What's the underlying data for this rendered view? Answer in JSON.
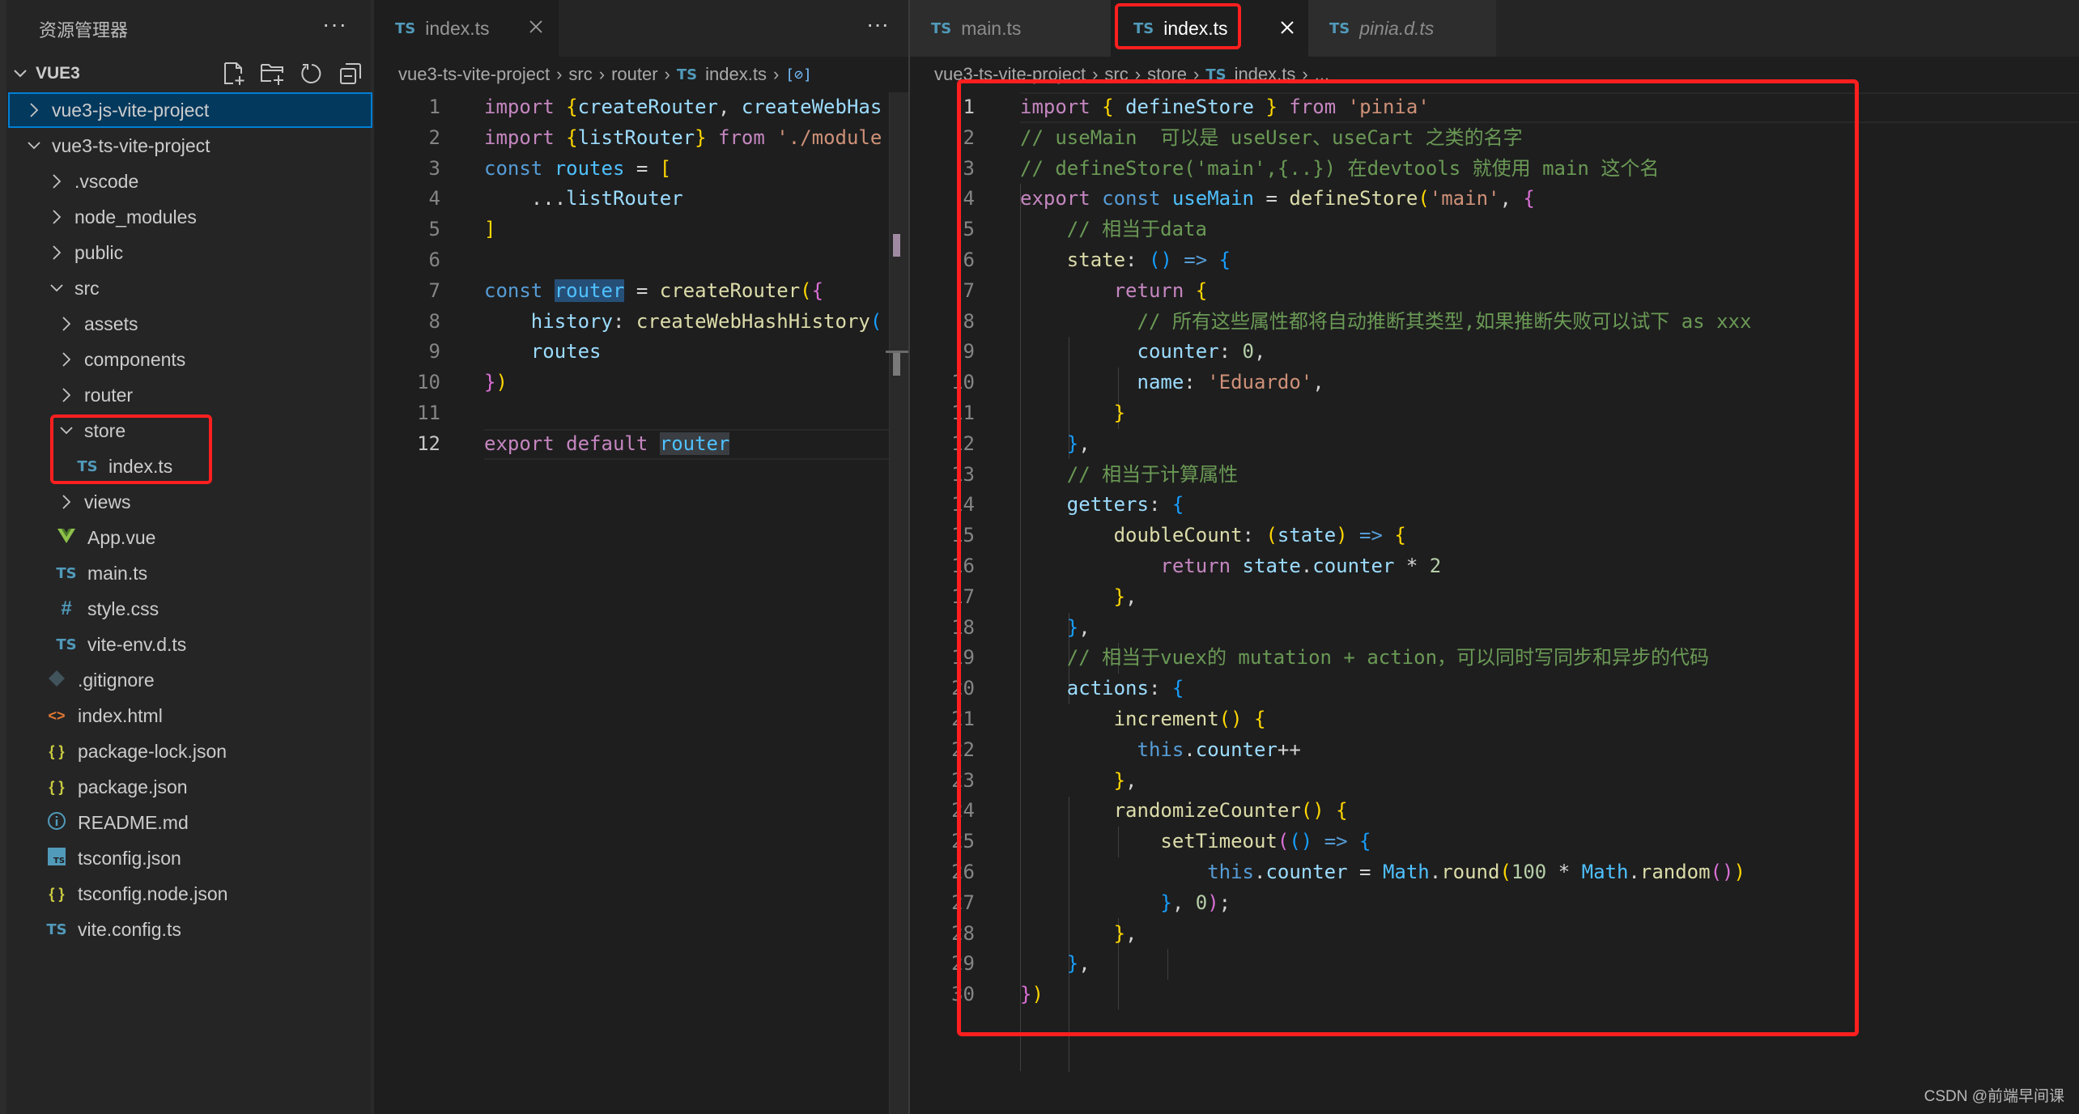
{
  "sidebar": {
    "title": "资源管理器",
    "more_icon": "···",
    "section": "VUE3",
    "actions": [
      "new-file",
      "new-folder",
      "refresh",
      "collapse-all"
    ],
    "tree": [
      {
        "label": "vue3-js-vite-project",
        "type": "folder",
        "expanded": false,
        "depth": 0,
        "selected": true
      },
      {
        "label": "vue3-ts-vite-project",
        "type": "folder",
        "expanded": true,
        "depth": 0
      },
      {
        "label": ".vscode",
        "type": "folder",
        "expanded": false,
        "depth": 1
      },
      {
        "label": "node_modules",
        "type": "folder",
        "expanded": false,
        "depth": 1
      },
      {
        "label": "public",
        "type": "folder",
        "expanded": false,
        "depth": 1
      },
      {
        "label": "src",
        "type": "folder",
        "expanded": true,
        "depth": 1
      },
      {
        "label": "assets",
        "type": "folder",
        "expanded": false,
        "depth": 2
      },
      {
        "label": "components",
        "type": "folder",
        "expanded": false,
        "depth": 2
      },
      {
        "label": "router",
        "type": "folder",
        "expanded": false,
        "depth": 2
      },
      {
        "label": "store",
        "type": "folder",
        "expanded": true,
        "depth": 2
      },
      {
        "label": "index.ts",
        "type": "ts",
        "depth": 3
      },
      {
        "label": "views",
        "type": "folder",
        "expanded": false,
        "depth": 2
      },
      {
        "label": "App.vue",
        "type": "vue",
        "depth": 2
      },
      {
        "label": "main.ts",
        "type": "ts",
        "depth": 2
      },
      {
        "label": "style.css",
        "type": "css",
        "depth": 2
      },
      {
        "label": "vite-env.d.ts",
        "type": "ts",
        "depth": 2
      },
      {
        "label": ".gitignore",
        "type": "git",
        "depth": 1
      },
      {
        "label": "index.html",
        "type": "html",
        "depth": 1
      },
      {
        "label": "package-lock.json",
        "type": "json",
        "depth": 1
      },
      {
        "label": "package.json",
        "type": "json",
        "depth": 1
      },
      {
        "label": "README.md",
        "type": "info",
        "depth": 1
      },
      {
        "label": "tsconfig.json",
        "type": "tsconfig",
        "depth": 1
      },
      {
        "label": "tsconfig.node.json",
        "type": "json",
        "depth": 1
      },
      {
        "label": "vite.config.ts",
        "type": "ts",
        "depth": 1
      }
    ]
  },
  "left_editor": {
    "tab": {
      "icon": "TS",
      "label": "index.ts",
      "close": "×"
    },
    "more_icon": "···",
    "breadcrumb": [
      "vue3-ts-vite-project",
      "src",
      "router",
      "index.ts"
    ],
    "current_line": 12,
    "lines": [
      [
        [
          "k",
          "import "
        ],
        [
          "y",
          "{"
        ],
        [
          "v",
          "createRouter"
        ],
        [
          "p",
          ", "
        ],
        [
          "v",
          "createWebHas"
        ]
      ],
      [
        [
          "k",
          "import "
        ],
        [
          "y",
          "{"
        ],
        [
          "v",
          "listRouter"
        ],
        [
          "y",
          "}"
        ],
        [
          "k",
          " from "
        ],
        [
          "s",
          "'./module"
        ]
      ],
      [
        [
          "b",
          "const "
        ],
        [
          "c",
          "routes"
        ],
        [
          "p",
          " = "
        ],
        [
          "y",
          "["
        ]
      ],
      [
        [
          "p",
          "    ..."
        ],
        [
          "v",
          "listRouter"
        ]
      ],
      [
        [
          "y",
          "]"
        ]
      ],
      [],
      [
        [
          "b",
          "const "
        ],
        [
          "c hl",
          "router"
        ],
        [
          "p",
          " = "
        ],
        [
          "f",
          "createRouter"
        ],
        [
          "y",
          "("
        ],
        [
          "m",
          "{"
        ]
      ],
      [
        [
          "v",
          "    history"
        ],
        [
          "p",
          ": "
        ],
        [
          "f",
          "createWebHashHistory"
        ],
        [
          "bl",
          "("
        ]
      ],
      [
        [
          "v",
          "    routes"
        ]
      ],
      [
        [
          "m",
          "}"
        ],
        [
          "y",
          ")"
        ]
      ],
      [],
      [
        [
          "k",
          "export default "
        ],
        [
          "c hl2",
          "router"
        ]
      ]
    ]
  },
  "right_editor": {
    "tabs": [
      {
        "icon": "TS",
        "label": "main.ts",
        "active": false
      },
      {
        "icon": "TS",
        "label": "index.ts",
        "active": true,
        "close": "×"
      },
      {
        "icon": "TS",
        "label": "pinia.d.ts",
        "active": false,
        "preview": true
      }
    ],
    "breadcrumb": [
      "vue3-ts-vite-project",
      "src",
      "store",
      "index.ts",
      "..."
    ],
    "current_line": 1,
    "lines": [
      [
        [
          "k",
          "import "
        ],
        [
          "y",
          "{ "
        ],
        [
          "v",
          "defineStore"
        ],
        [
          "y",
          " }"
        ],
        [
          "k",
          " from "
        ],
        [
          "s",
          "'pinia'"
        ]
      ],
      [
        [
          "cm",
          "// useMain  可以是 useUser、useCart 之类的名字"
        ]
      ],
      [
        [
          "cm",
          "// defineStore('main',{..}) 在devtools 就使用 main 这个名"
        ]
      ],
      [
        [
          "k",
          "export "
        ],
        [
          "b",
          "const "
        ],
        [
          "c",
          "useMain"
        ],
        [
          "p",
          " = "
        ],
        [
          "f",
          "defineStore"
        ],
        [
          "y",
          "("
        ],
        [
          "s",
          "'main'"
        ],
        [
          "p",
          ", "
        ],
        [
          "m",
          "{"
        ]
      ],
      [
        [
          "cm",
          "    // 相当于data"
        ]
      ],
      [
        [
          "f",
          "    state"
        ],
        [
          "p",
          ": "
        ],
        [
          "bl",
          "()"
        ],
        [
          "b",
          " => "
        ],
        [
          "bl",
          "{"
        ]
      ],
      [
        [
          "k",
          "        return "
        ],
        [
          "y",
          "{"
        ]
      ],
      [
        [
          "cm",
          "          // 所有这些属性都将自动推断其类型,如果推断失败可以试下 as xxx"
        ]
      ],
      [
        [
          "v",
          "          counter"
        ],
        [
          "p",
          ": "
        ],
        [
          "n",
          "0"
        ],
        [
          "p",
          ","
        ]
      ],
      [
        [
          "v",
          "          name"
        ],
        [
          "p",
          ": "
        ],
        [
          "s",
          "'Eduardo'"
        ],
        [
          "p",
          ","
        ]
      ],
      [
        [
          "y",
          "        }"
        ]
      ],
      [
        [
          "bl",
          "    }"
        ],
        [
          "p",
          ","
        ]
      ],
      [
        [
          "cm",
          "    // 相当于计算属性"
        ]
      ],
      [
        [
          "v",
          "    getters"
        ],
        [
          "p",
          ": "
        ],
        [
          "bl",
          "{"
        ]
      ],
      [
        [
          "f",
          "        doubleCount"
        ],
        [
          "p",
          ": "
        ],
        [
          "y",
          "("
        ],
        [
          "v",
          "state"
        ],
        [
          "y",
          ")"
        ],
        [
          "b",
          " => "
        ],
        [
          "y",
          "{"
        ]
      ],
      [
        [
          "k",
          "            return "
        ],
        [
          "v",
          "state"
        ],
        [
          "p",
          "."
        ],
        [
          "v",
          "counter"
        ],
        [
          "p",
          " * "
        ],
        [
          "n",
          "2"
        ]
      ],
      [
        [
          "y",
          "        }"
        ],
        [
          "p",
          ","
        ]
      ],
      [
        [
          "bl",
          "    }"
        ],
        [
          "p",
          ","
        ]
      ],
      [
        [
          "cm",
          "    // 相当于vuex的 mutation + action，可以同时写同步和异步的代码"
        ]
      ],
      [
        [
          "v",
          "    actions"
        ],
        [
          "p",
          ": "
        ],
        [
          "bl",
          "{"
        ]
      ],
      [
        [
          "f",
          "        increment"
        ],
        [
          "y",
          "() {"
        ]
      ],
      [
        [
          "b",
          "          this"
        ],
        [
          "p",
          "."
        ],
        [
          "v",
          "counter"
        ],
        [
          "p",
          "++"
        ]
      ],
      [
        [
          "y",
          "        }"
        ],
        [
          "p",
          ","
        ]
      ],
      [
        [
          "f",
          "        randomizeCounter"
        ],
        [
          "y",
          "() {"
        ]
      ],
      [
        [
          "f",
          "            setTimeout"
        ],
        [
          "m",
          "("
        ],
        [
          "bl",
          "()"
        ],
        [
          "b",
          " => "
        ],
        [
          "bl",
          "{"
        ]
      ],
      [
        [
          "b",
          "                this"
        ],
        [
          "p",
          "."
        ],
        [
          "v",
          "counter"
        ],
        [
          "p",
          " = "
        ],
        [
          "c",
          "Math"
        ],
        [
          "p",
          "."
        ],
        [
          "f",
          "round"
        ],
        [
          "y",
          "("
        ],
        [
          "n",
          "100"
        ],
        [
          "p",
          " * "
        ],
        [
          "c",
          "Math"
        ],
        [
          "p",
          "."
        ],
        [
          "f",
          "random"
        ],
        [
          "m",
          "()"
        ],
        [
          "y",
          ")"
        ]
      ],
      [
        [
          "bl",
          "            }"
        ],
        [
          "p",
          ", "
        ],
        [
          "n",
          "0"
        ],
        [
          "m",
          ")"
        ],
        [
          "p",
          ";"
        ]
      ],
      [
        [
          "y",
          "        }"
        ],
        [
          "p",
          ","
        ]
      ],
      [
        [
          "bl",
          "    }"
        ],
        [
          "p",
          ","
        ]
      ],
      [
        [
          "m",
          "}"
        ],
        [
          "y",
          ")"
        ]
      ]
    ]
  },
  "watermark": "CSDN @前端早间课",
  "colors": {
    "annotation_red": "#ff1f1f",
    "selection_blue": "#04395e",
    "ts_icon": "#519aba"
  }
}
